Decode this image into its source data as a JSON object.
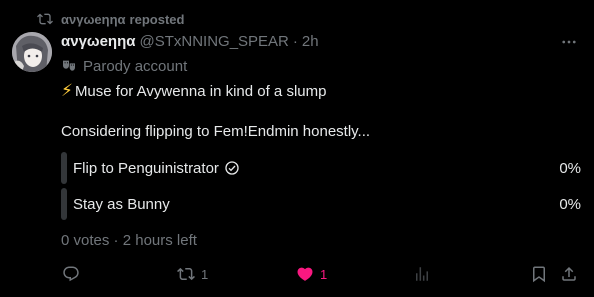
{
  "repost": {
    "user": "ανγωеηηα",
    "label": "reposted",
    "icon": "repost-icon"
  },
  "post": {
    "display_name": "ανγωеηηα",
    "handle": "@STxNNING_SPEAR",
    "separator": "·",
    "time": "2h",
    "parody_label": "Parody account",
    "line1_emoji": "⚡",
    "line1_text": "Muse for Avywenna in kind of a slump",
    "line2_text": "Considering flipping to Fem!Endmin honestly..."
  },
  "poll": {
    "options": [
      {
        "label": "Flip to Penguinistrator",
        "percent": "0%",
        "selected": true
      },
      {
        "label": "Stay as Bunny",
        "percent": "0%",
        "selected": false
      }
    ],
    "votes": "0 votes",
    "separator": "·",
    "time_left": "2 hours left"
  },
  "actions": {
    "reply_count": "",
    "repost_count": "1",
    "like_count": "1",
    "views_count": ""
  },
  "colors": {
    "accent_like": "#f91880",
    "muted": "#71767b",
    "background": "#000000",
    "text": "#e7e9ea"
  }
}
